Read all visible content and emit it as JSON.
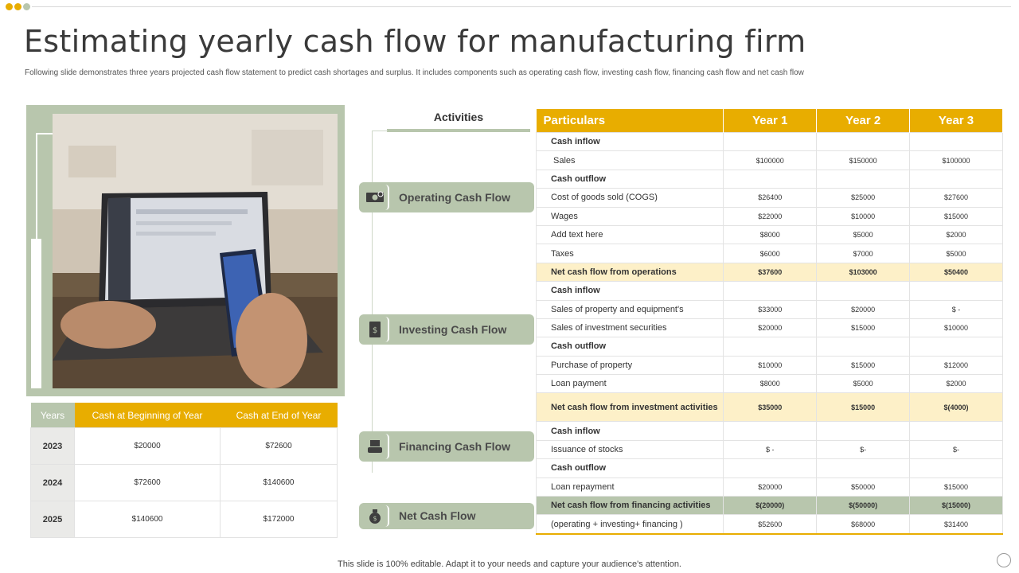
{
  "colors": {
    "gold": "#e8ad00",
    "sage": "#b8c6ad",
    "highlight": "#fdf0c8"
  },
  "window_dots": [
    "#e8ad00",
    "#e8ad00",
    "#b8c6ad"
  ],
  "title": "Estimating yearly cash flow for manufacturing firm",
  "subtitle": "Following slide demonstrates three years projected cash flow statement to predict cash shortages and surplus. It includes components such as operating cash flow, investing cash flow, financing cash flow and net cash flow",
  "years_table": {
    "headers": [
      "Years",
      "Cash at Beginning of Year",
      "Cash at End of Year"
    ],
    "rows": [
      {
        "year": "2023",
        "begin": "$20000",
        "end": "$72600"
      },
      {
        "year": "2024",
        "begin": "$72600",
        "end": "$140600"
      },
      {
        "year": "2025",
        "begin": "$140600",
        "end": "$172000"
      }
    ]
  },
  "activities": {
    "title": "Activities",
    "items": [
      {
        "label": "Operating Cash Flow",
        "icon": "cash-icon"
      },
      {
        "label": "Investing Cash Flow",
        "icon": "document-dollar-icon"
      },
      {
        "label": "Financing Cash Flow",
        "icon": "money-hand-icon"
      },
      {
        "label": "Net Cash Flow",
        "icon": "money-bag-icon"
      }
    ]
  },
  "main_table": {
    "headers": [
      "Particulars",
      "Year 1",
      "Year 2",
      "Year 3"
    ],
    "rows": [
      {
        "label": "Cash inflow",
        "y1": "",
        "y2": "",
        "y3": "",
        "style": "section"
      },
      {
        "label": "Sales",
        "y1": "$100000",
        "y2": "$150000",
        "y3": "$100000",
        "style": "indent"
      },
      {
        "label": "Cash outflow",
        "y1": "",
        "y2": "",
        "y3": "",
        "style": "section"
      },
      {
        "label": "Cost of goods sold (COGS)",
        "y1": "$26400",
        "y2": "$25000",
        "y3": "$27600",
        "style": ""
      },
      {
        "label": "Wages",
        "y1": "$22000",
        "y2": "$10000",
        "y3": "$15000",
        "style": ""
      },
      {
        "label": "Add text here",
        "y1": "$8000",
        "y2": "$5000",
        "y3": "$2000",
        "style": ""
      },
      {
        "label": "Taxes",
        "y1": "$6000",
        "y2": "$7000",
        "y3": "$5000",
        "style": ""
      },
      {
        "label": "Net cash flow from operations",
        "y1": "$37600",
        "y2": "$103000",
        "y3": "$50400",
        "style": "hl"
      },
      {
        "label": "Cash inflow",
        "y1": "",
        "y2": "",
        "y3": "",
        "style": "section"
      },
      {
        "label": "Sales of property and equipment's",
        "y1": "$33000",
        "y2": "$20000",
        "y3": "$ -",
        "style": ""
      },
      {
        "label": "Sales of investment securities",
        "y1": "$20000",
        "y2": "$15000",
        "y3": "$10000",
        "style": ""
      },
      {
        "label": "Cash outflow",
        "y1": "",
        "y2": "",
        "y3": "",
        "style": "section"
      },
      {
        "label": "Purchase of property",
        "y1": "$10000",
        "y2": "$15000",
        "y3": "$12000",
        "style": ""
      },
      {
        "label": "Loan payment",
        "y1": "$8000",
        "y2": "$5000",
        "y3": "$2000",
        "style": ""
      },
      {
        "label": "Net cash flow from investment activities",
        "y1": "$35000",
        "y2": "$15000",
        "y3": "$(4000)",
        "style": "hl tall"
      },
      {
        "label": "Cash inflow",
        "y1": "",
        "y2": "",
        "y3": "",
        "style": "section"
      },
      {
        "label": "Issuance of stocks",
        "y1": "$ -",
        "y2": "$-",
        "y3": "$-",
        "style": ""
      },
      {
        "label": "Cash outflow",
        "y1": "",
        "y2": "",
        "y3": "",
        "style": "section"
      },
      {
        "label": "Loan repayment",
        "y1": "$20000",
        "y2": "$50000",
        "y3": "$15000",
        "style": ""
      },
      {
        "label": "Net cash flow from financing activities",
        "y1": "$(20000)",
        "y2": "$(50000)",
        "y3": "$(15000)",
        "style": "gr"
      },
      {
        "label": "(operating + investing+ financing )",
        "y1": "$52600",
        "y2": "$68000",
        "y3": "$31400",
        "style": ""
      }
    ]
  },
  "footer": "This slide is 100% editable. Adapt it to your needs and capture your audience's attention."
}
